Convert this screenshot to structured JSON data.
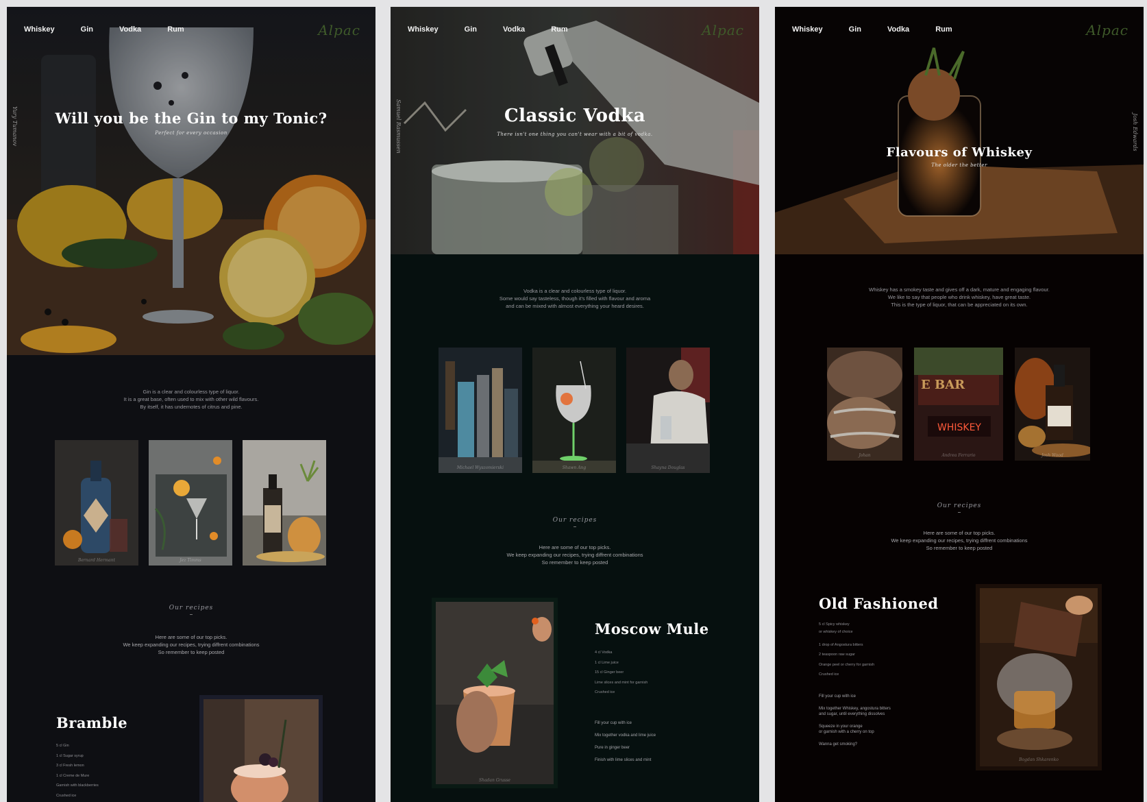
{
  "nav": [
    "Whiskey",
    "Gin",
    "Vodka",
    "Rum"
  ],
  "logo": "Alpac",
  "gin": {
    "side_credit": "Yury Tumanov",
    "title": "Will you be the Gin to my Tonic?",
    "subtitle": "Perfect for every occasion",
    "intro": [
      "Gin is a clear and colourless type of liquor.",
      "It is a great base, often used to mix with other wild flavours.",
      "By itself, it has undernotes of citrus and pine."
    ],
    "thumb_credits": [
      "Bernard Hermant",
      "Jez Timms",
      ""
    ],
    "recipes_heading": "Our recipes",
    "recipes_text": [
      "Here are some of our top picks.",
      "We keep expanding our recipes, trying diffrent combinations",
      "So remember to keep posted"
    ],
    "recipe": {
      "name": "Bramble",
      "ingredients": [
        "5 cl Gin",
        "1 cl Sugar syrup",
        "3 cl Fresh lemon",
        "1 cl Creme de Mure",
        "Garnish with blackberries",
        "Crushed ice"
      ]
    }
  },
  "vodka": {
    "side_credit": "Samuel Rasmussen",
    "title": "Classic Vodka",
    "subtitle": "There isn't one thing you can't wear with a bit of vodka.",
    "intro": [
      "Vodka is a clear and colourless type of liquor.",
      "Some would say tasteless, though it's filled with flavour and aroma",
      "and can be mixed with almost everything your heard desires."
    ],
    "thumb_credits": [
      "Michael Wyszomierski",
      "Shawn Ang",
      "Shayna Douglas"
    ],
    "recipes_heading": "Our recipes",
    "recipes_text": [
      "Here are some of our top picks.",
      "We keep expanding our recipes, trying diffrent combinations",
      "So remember to keep posted"
    ],
    "recipe": {
      "name": "Moscow Mule",
      "ingredients": [
        "4 cl Vodka",
        "1 cl Lime juice",
        "15 cl Ginger beer",
        "Lime slices and mint for garnish",
        "Crushed ice"
      ],
      "steps": [
        "Fill your cup with ice",
        "Mix together vodka and lime juice",
        "Pure in ginger beer",
        "Finish with lime slices and mint"
      ],
      "image_credit": "Shadan Grusse"
    }
  },
  "whiskey": {
    "side_credit": "Josh Edwards",
    "title": "Flavours of Whiskey",
    "subtitle": "The older the better",
    "intro": [
      "Whiskey has a smokey taste and gives off a dark, mature and engaging flavour.",
      "We like to say that people who drink whiskey, have great taste.",
      "This is the type of liquor, that can be appreciated on its own."
    ],
    "thumb_credits": [
      "Johan",
      "Andrea Ferrario",
      "Josh Wood"
    ],
    "sign_text": "WHISKEY",
    "sign_top": "E BAR",
    "recipes_heading": "Our recipes",
    "recipes_text": [
      "Here are some of our top picks.",
      "We keep expanding our recipes, trying diffrent combinations",
      "So remember to keep posted"
    ],
    "recipe": {
      "name": "Old Fashioned",
      "ingredients": [
        "5 cl Spicy whiskey",
        "or whiskey of choice",
        "1 drop of Angostura bitters",
        "2 teaspoon raw sugar",
        "Orange peel or cherry for garnish",
        "Crushed ice"
      ],
      "steps": [
        "Fill your cup with ice",
        "Mix together Whiskey, angostura bitters",
        "and sugar, until everything dissolves",
        "Squeeze in your orange",
        "or garnish with a cherry on top",
        "Wanna get smoking?"
      ],
      "image_credit": "Bogdan Shkarenko"
    }
  }
}
